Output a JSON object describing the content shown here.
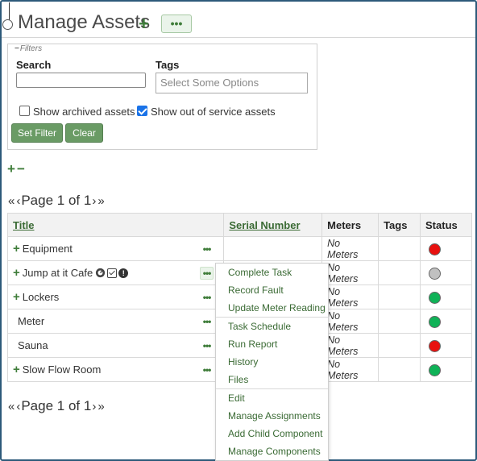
{
  "page": {
    "title": "Manage Assets",
    "plus_glyph": "+",
    "more_glyph": "•••"
  },
  "filters": {
    "legend": "Filters",
    "search_label": "Search",
    "search_value": "",
    "tags_label": "Tags",
    "tags_placeholder": "Select Some Options",
    "show_archived_label": "Show archived assets",
    "show_archived_checked": false,
    "show_out_of_service_label": "Show out of service assets",
    "show_out_of_service_checked": true,
    "set_filter_label": "Set Filter",
    "clear_label": "Clear"
  },
  "tree_controls": {
    "expand": "+",
    "collapse": "−"
  },
  "pager": {
    "first": "«",
    "prev": "‹",
    "label": "Page 1 of 1",
    "next": "›",
    "last": "»"
  },
  "table": {
    "headers": {
      "title": "Title",
      "serial": "Serial Number",
      "meters": "Meters",
      "tags": "Tags",
      "status": "Status"
    },
    "rows": [
      {
        "title": "Equipment",
        "expandable": true,
        "serial": "",
        "meters": "No Meters",
        "tags": "",
        "status": "red"
      },
      {
        "title": "Jump at it Cafe",
        "expandable": true,
        "serial": "",
        "meters": "No Meters",
        "tags": "",
        "status": "gray",
        "icons": [
          "gauge-icon",
          "checkbox-icon",
          "alert-icon"
        ]
      },
      {
        "title": "Lockers",
        "expandable": true,
        "serial": "",
        "meters": "No Meters",
        "tags": "",
        "status": "green"
      },
      {
        "title": "Meter",
        "expandable": false,
        "serial": "",
        "meters": "No Meters",
        "tags": "",
        "status": "green"
      },
      {
        "title": "Sauna",
        "expandable": false,
        "serial": "",
        "meters": "No Meters",
        "tags": "",
        "status": "red"
      },
      {
        "title": "Slow Flow Room",
        "expandable": true,
        "serial": "",
        "meters": "No Meters",
        "tags": "",
        "status": "green"
      }
    ]
  },
  "context_menu": {
    "groups": [
      [
        "Complete Task",
        "Record Fault",
        "Update Meter Reading"
      ],
      [
        "Task Schedule",
        "Run Report",
        "History",
        "Files"
      ],
      [
        "Edit",
        "Manage Assignments",
        "Add Child Component",
        "Manage Components"
      ]
    ]
  },
  "colors": {
    "accent": "#3f7d3a",
    "button": "#6a9b65",
    "status_red": "#e8110f",
    "status_green": "#0fb257",
    "status_gray": "#c0c0c0",
    "frame": "#2d5a7a"
  }
}
